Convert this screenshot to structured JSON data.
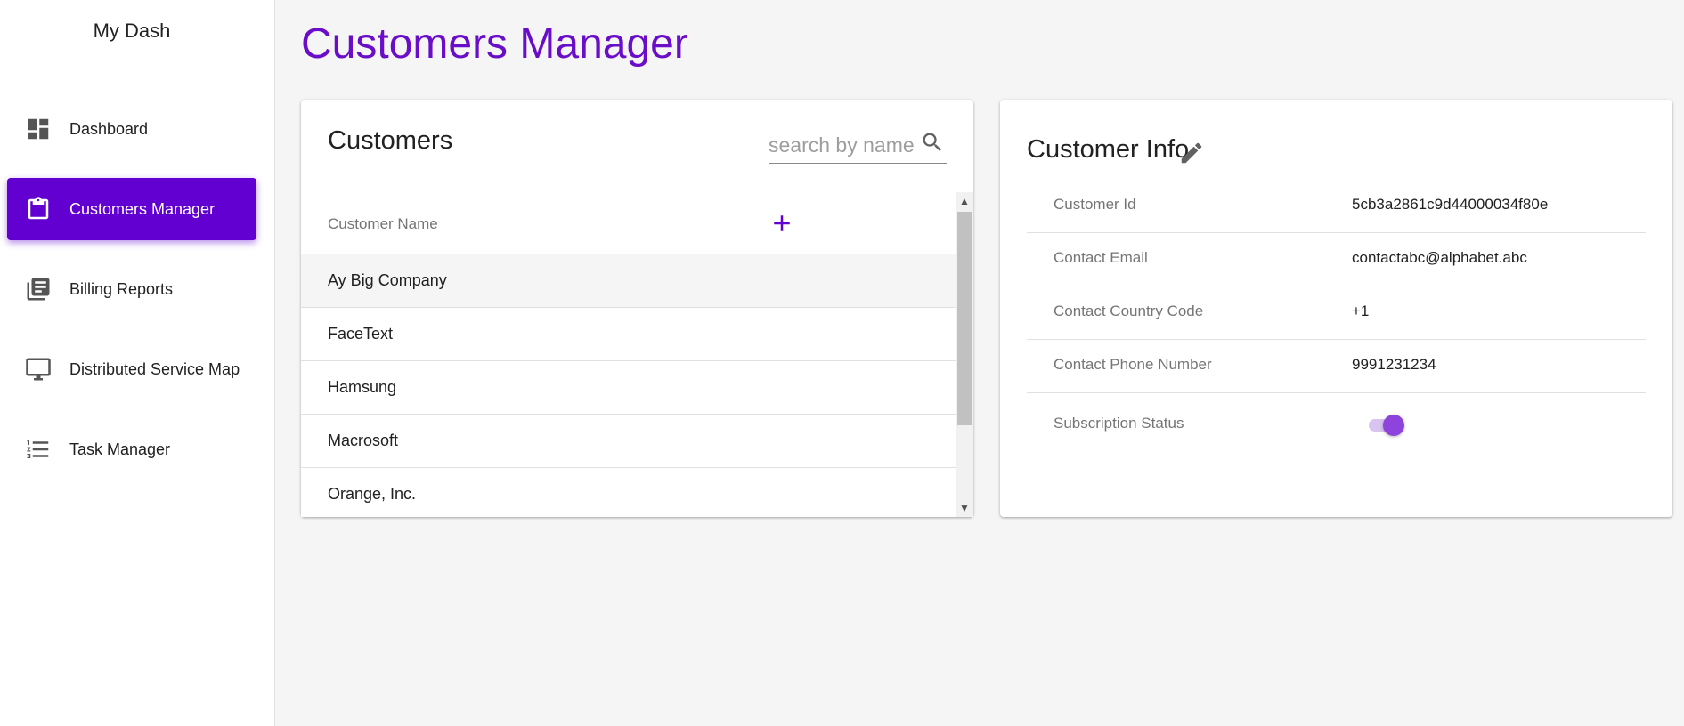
{
  "app": {
    "brand": "My Dash"
  },
  "colors": {
    "accent": "#6200d2",
    "title": "#6a0dc9",
    "toggle_on": "#8e44dc"
  },
  "sidebar": {
    "items": [
      {
        "label": "Dashboard",
        "icon": "dashboard-icon",
        "active": false
      },
      {
        "label": "Customers Manager",
        "icon": "clipboard-icon",
        "active": true
      },
      {
        "label": "Billing Reports",
        "icon": "library-books-icon",
        "active": false
      },
      {
        "label": "Distributed Service Map",
        "icon": "monitor-icon",
        "active": false
      },
      {
        "label": "Task Manager",
        "icon": "list-icon",
        "active": false
      }
    ]
  },
  "page": {
    "title": "Customers Manager"
  },
  "customers": {
    "title": "Customers",
    "search": {
      "placeholder": "search by name",
      "value": ""
    },
    "column_header": "Customer Name",
    "add_icon": "plus-icon",
    "rows": [
      {
        "name": "Ay Big Company",
        "selected": true
      },
      {
        "name": "FaceText",
        "selected": false
      },
      {
        "name": "Hamsung",
        "selected": false
      },
      {
        "name": "Macrosoft",
        "selected": false
      },
      {
        "name": "Orange, Inc.",
        "selected": false
      }
    ]
  },
  "info": {
    "title": "Customer Info",
    "edit_icon": "pencil-icon",
    "fields": [
      {
        "label": "Customer Id",
        "value": "5cb3a2861c9d44000034f80e"
      },
      {
        "label": "Contact Email",
        "value": "contactabc@alphabet.abc"
      },
      {
        "label": "Contact Country Code",
        "value": "+1"
      },
      {
        "label": "Contact Phone Number",
        "value": "9991231234"
      }
    ],
    "subscription": {
      "label": "Subscription Status",
      "enabled": true
    }
  }
}
